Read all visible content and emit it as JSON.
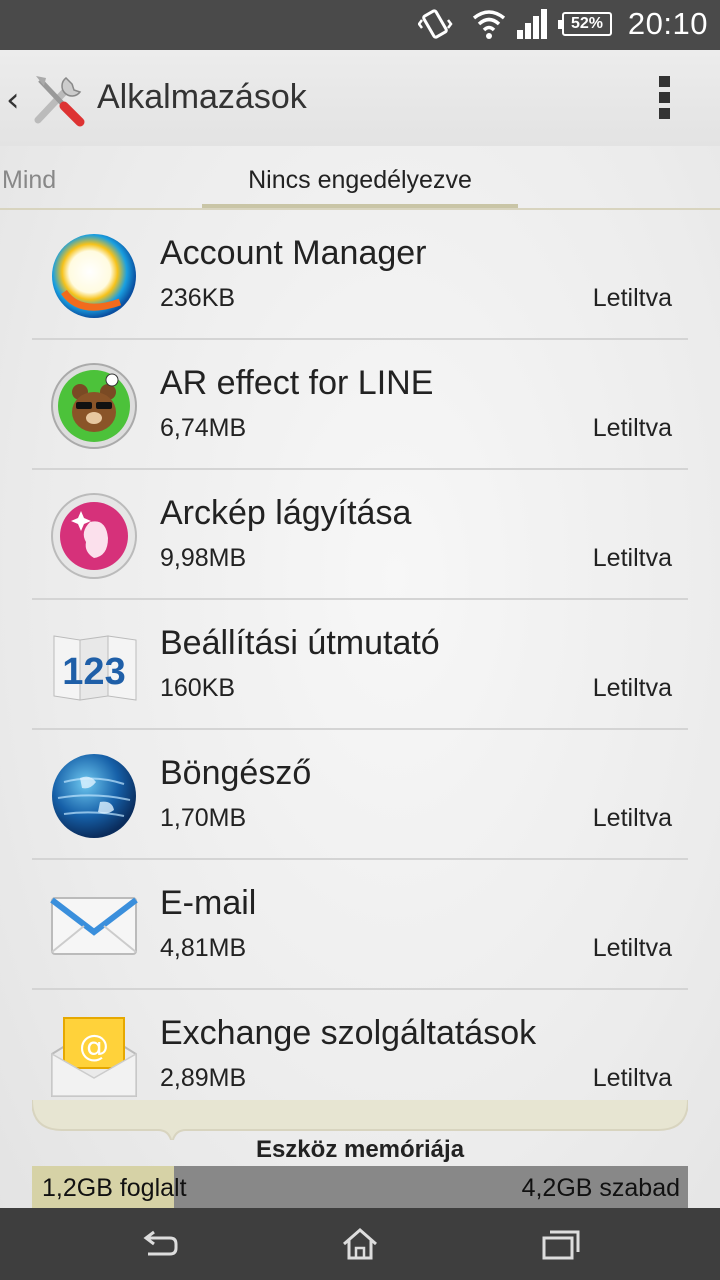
{
  "status_bar": {
    "icons": [
      "vibrate-icon",
      "wifi-icon",
      "signal-icon"
    ],
    "battery": "52%",
    "clock": "20:10"
  },
  "action_bar": {
    "back_icon": "chevron-left-icon",
    "app_icon": "tools-icon",
    "title": "Alkalmazások",
    "menu_icon": "overflow-menu-icon"
  },
  "tabs": {
    "items": [
      {
        "label": "Mind",
        "active": false
      },
      {
        "label": "Nincs engedélyezve",
        "active": true
      }
    ]
  },
  "apps": [
    {
      "name": "Account Manager",
      "size": "236KB",
      "status": "Letiltva",
      "icon": "account-manager-icon"
    },
    {
      "name": "AR effect for LINE",
      "size": "6,74MB",
      "status": "Letiltva",
      "icon": "line-bear-icon"
    },
    {
      "name": "Arckép lágyítása",
      "size": "9,98MB",
      "status": "Letiltva",
      "icon": "face-soften-icon"
    },
    {
      "name": "Beállítási útmutató",
      "size": "160KB",
      "status": "Letiltva",
      "icon": "setup-guide-123-icon"
    },
    {
      "name": "Böngésző",
      "size": "1,70MB",
      "status": "Letiltva",
      "icon": "browser-globe-icon"
    },
    {
      "name": "E-mail",
      "size": "4,81MB",
      "status": "Letiltva",
      "icon": "email-envelope-icon"
    },
    {
      "name": "Exchange szolgáltatások",
      "size": "2,89MB",
      "status": "Letiltva",
      "icon": "exchange-mail-icon"
    }
  ],
  "storage": {
    "label": "Eszköz memóriája",
    "used": "1,2GB foglalt",
    "free": "4,2GB szabad",
    "used_fraction": 0.216
  },
  "nav_bar": {
    "icons": [
      "back-icon",
      "home-icon",
      "recent-apps-icon"
    ]
  },
  "colors": {
    "status_bar": "#4a4a4a",
    "nav_bar": "#3e3e3e",
    "tab_indicator": "#c9c5a6",
    "storage_used": "#d6d2a6",
    "storage_free": "#888888"
  }
}
